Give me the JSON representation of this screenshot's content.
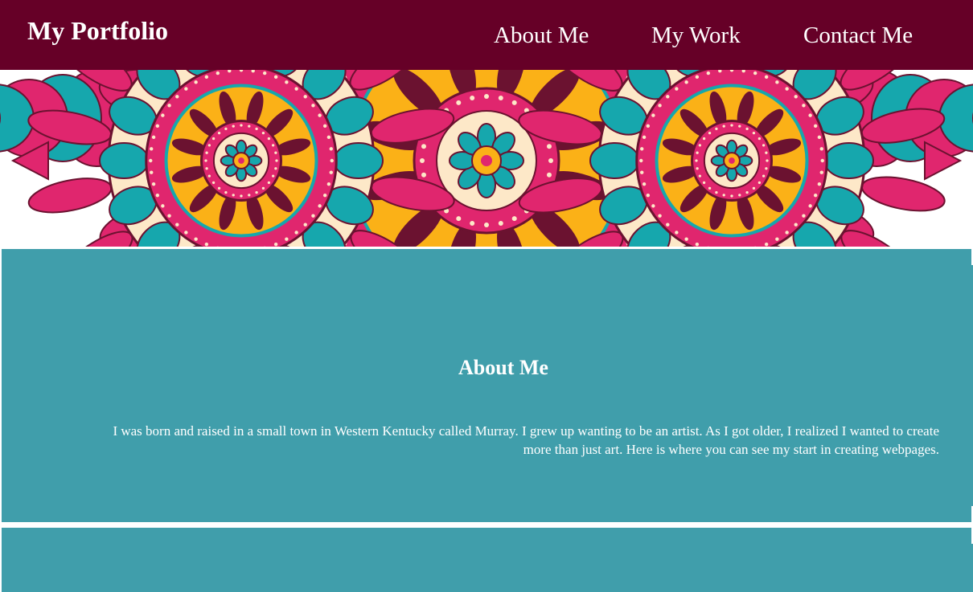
{
  "header": {
    "brand": "My Portfolio",
    "nav": [
      {
        "label": "About Me"
      },
      {
        "label": "My Work"
      },
      {
        "label": "Contact Me"
      }
    ]
  },
  "banner": {
    "icon": "mandala-illustration"
  },
  "about": {
    "title": "About Me",
    "text": "I was born and raised in a small town in Western Kentucky called Murray. I grew up wanting to be an artist. As I got older, I realized I wanted to create more than just art. Here is where you can see my start in creating webpages."
  },
  "colors": {
    "header_bg": "#660027",
    "section_bg": "#409eab",
    "mandala_pink": "#e0266e",
    "mandala_teal": "#16a7ad",
    "mandala_yellow": "#fbb117",
    "mandala_cream": "#fde8c8",
    "mandala_maroon": "#6b1230"
  }
}
